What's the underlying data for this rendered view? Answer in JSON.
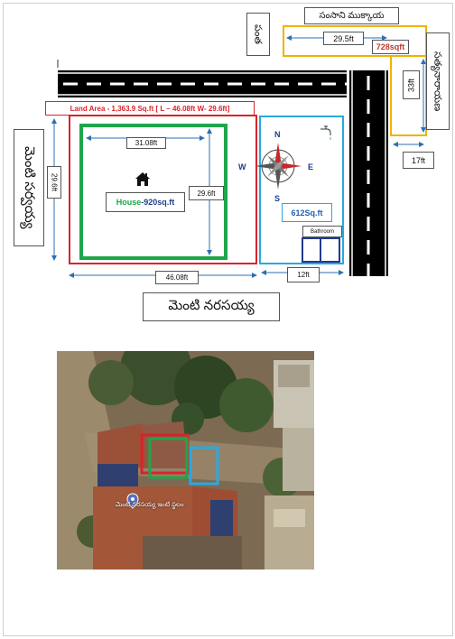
{
  "labels": {
    "north_owner": "సంసాని ముక్కాయ",
    "corner_owner": "పంత",
    "east_owner": "సత్యనారాయణ",
    "west_owner": "మెంటి సర్వయ్య",
    "south_owner": "మెంటి నరసయ్య",
    "land_area": "Land Area - 1,363.9 Sq.ft [ L – 46.08ft   W- 29.6ft]",
    "house_label_prefix": "House",
    "house_label_suffix": "-920sq.ft",
    "plot_612": "612Sq.ft",
    "bathroom": "Bathroom",
    "sqft_728": "728sqft"
  },
  "dimensions": {
    "top_29_5": "29.5ft",
    "right_33": "33ft",
    "right_17": "17ft",
    "house_31_08": "31.08ft",
    "house_29_6": "29.6ft",
    "left_29_6": "29.6ft",
    "bottom_46_08": "46.08ft",
    "bottom_12": "12ft"
  },
  "compass": {
    "n": "N",
    "s": "S",
    "e": "E",
    "w": "W"
  },
  "satellite": {
    "caption": "మెంటి నరసయ్య ఇంటి స్థలం"
  },
  "colors": {
    "land_border": "#d9232a",
    "house_border": "#1ea64a",
    "plot_border": "#2aa8e0",
    "yellow_border": "#f2b100",
    "bathroom_border": "#1f3d8a",
    "sqft_728_text": "#c0392b",
    "house_text": "#1ea64a",
    "plot_text": "#1f5fb4"
  },
  "icons": [
    "house-icon",
    "tap-icon",
    "compass-rose-icon",
    "location-pin-icon"
  ]
}
